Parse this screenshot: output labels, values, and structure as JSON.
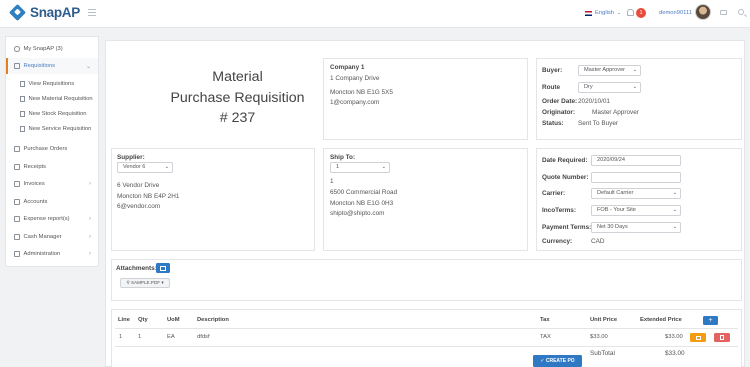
{
  "topbar": {
    "logo_text": "SnapAP",
    "language": "English",
    "notification_count": "1",
    "username": "demon90111"
  },
  "sidebar": {
    "items": [
      {
        "label": "My SnapAP (3)"
      },
      {
        "label": "Requisitions"
      },
      {
        "label": "Purchase Orders"
      },
      {
        "label": "Receipts"
      },
      {
        "label": "Invoices"
      },
      {
        "label": "Accounts"
      },
      {
        "label": "Expense report(s)"
      },
      {
        "label": "Cash Manager"
      },
      {
        "label": "Administration"
      }
    ],
    "sub_items": [
      {
        "label": "View Requisitions"
      },
      {
        "label": "New Material Requisition"
      },
      {
        "label": "New Stock Requisition"
      },
      {
        "label": "New Service Requisition"
      }
    ]
  },
  "header": {
    "title_line1": "Material",
    "title_line2": "Purchase Requisition",
    "title_line3": "# 237"
  },
  "company": {
    "name": "Company 1",
    "address1": "1 Company Drive",
    "address2": "Moncton NB E1G 5X5",
    "email": "1@company.com"
  },
  "buyer_panel": {
    "buyer_label": "Buyer:",
    "buyer_value": "Master Approver",
    "route_label": "Route",
    "route_value": "Dry",
    "order_date_label": "Order Date:",
    "order_date_value": "2020/10/01",
    "originator_label": "Originator:",
    "originator_value": "Master Approver",
    "status_label": "Status:",
    "status_value": "Sent To Buyer"
  },
  "supplier": {
    "label": "Supplier:",
    "value": "Vendor 6",
    "address1": "6 Vendor Drive",
    "address2": "Moncton NB E4P 2H1",
    "email": "6@vendor.com"
  },
  "shipto": {
    "label": "Ship To:",
    "value": "1",
    "line0": "1",
    "address1": "6500 Commercial Road",
    "address2": "Moncton NB E1G 0H3",
    "email": "shipto@shipto.com"
  },
  "details": {
    "date_required_label": "Date Required:",
    "date_required_value": "2020/09/24",
    "quote_label": "Quote Number:",
    "quote_value": "",
    "carrier_label": "Carrier:",
    "carrier_value": "Default Carrier",
    "incoterms_label": "IncoTerms:",
    "incoterms_value": "FOB - Your Site",
    "payment_label": "Payment Terms:",
    "payment_value": "Net 30 Days",
    "currency_label": "Currency:",
    "currency_value": "CAD"
  },
  "attachments": {
    "label": "Attachments:",
    "file": "SAMPLE.PDF"
  },
  "lines": {
    "headers": {
      "line": "Line",
      "qty": "Qty",
      "uom": "UoM",
      "description": "Description",
      "tax": "Tax",
      "unit_price": "Unit Price",
      "extended_price": "Extended Price"
    },
    "add_label": "+",
    "row": {
      "line": "1",
      "qty": "1",
      "uom": "EA",
      "description": "dfdsf",
      "tax": "TAX",
      "unit_price": "$33.00",
      "extended_price": "$33.00"
    },
    "subtotal_label": "SubTotal",
    "subtotal_value": "$33.00",
    "create_po_label": "✓ CREATE PO"
  },
  "colors": {
    "accent": "#2f78c4",
    "active_border": "#e67e22",
    "edit": "#f39c12",
    "delete": "#e46262"
  }
}
